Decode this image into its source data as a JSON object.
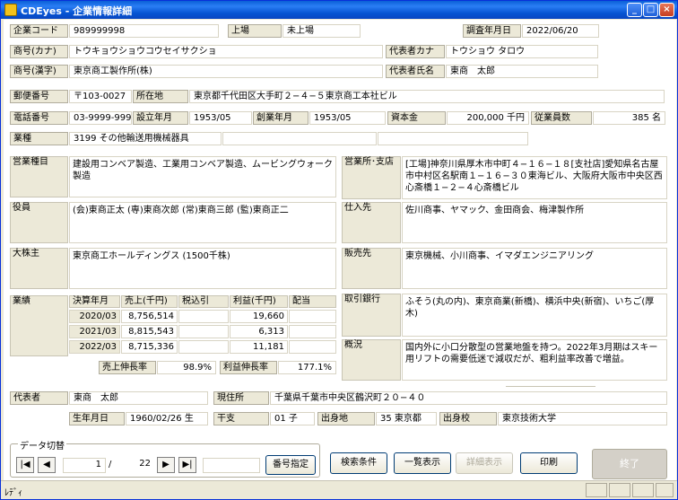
{
  "window": {
    "title": "CDEyes - 企業情報詳細",
    "min": "_",
    "max": "□",
    "close": "×"
  },
  "row1": {
    "company_code_label": "企業コード",
    "company_code": "989999998",
    "listed_label": "上場",
    "listed": "未上場",
    "survey_date_label": "調査年月日",
    "survey_date": "2022/06/20"
  },
  "row2": {
    "name_kana_label": "商号(カナ)",
    "name_kana": "トウキョウショウコウセイサクショ",
    "rep_kana_label": "代表者カナ",
    "rep_kana": "トウショウ タロウ"
  },
  "row3": {
    "name_kanji_label": "商号(漢字)",
    "name_kanji": "東京商工製作所(株)",
    "rep_name_label": "代表者氏名",
    "rep_name": "東商　太郎"
  },
  "row4": {
    "postal_label": "郵便番号",
    "postal": "〒103-0027",
    "address_label": "所在地",
    "address": "東京都千代田区大手町２−４−５東京商工本社ビル"
  },
  "row5": {
    "phone_label": "電話番号",
    "phone": "03-9999-9999",
    "est_label": "設立年月",
    "est": "1953/05",
    "found_label": "創業年月",
    "found": "1953/05",
    "capital_label": "資本金",
    "capital": "200,000 千円",
    "employees_label": "従業員数",
    "employees": "385 名"
  },
  "row6": {
    "industry_label": "業種",
    "industry": "3199 その他輸送用機械器具"
  },
  "business": {
    "label": "営業種目",
    "text": "建設用コンベア製造、工業用コンベア製造、ムービングウォーク製造"
  },
  "offices": {
    "label": "営業所･支店",
    "text": "[工場]神奈川県厚木市中町４−１６−１８[支社店]愛知県名古屋市中村区名駅南１−１６−３０東海ビル、大阪府大阪市中央区西心斎橋１−２−４心斎橋ビル"
  },
  "officers": {
    "label": "役員",
    "text": "(会)東商正太 (専)東商次郎 (常)東商三郎 (監)東商正二"
  },
  "suppliers": {
    "label": "仕入先",
    "text": "佐川商事、ヤマック、金田商会、梅津製作所"
  },
  "shareholders": {
    "label": "大株主",
    "text": "東京商工ホールディングス (1500千株)"
  },
  "customers": {
    "label": "販売先",
    "text": "東京機械、小川商事、イマダエンジニアリング"
  },
  "performance": {
    "label": "業績",
    "headers": [
      "決算年月",
      "売上(千円)",
      "税込引",
      "利益(千円)",
      "配当"
    ],
    "rows": [
      {
        "period": "2020/03",
        "sales": "8,756,514",
        "tax": "",
        "profit": "19,660",
        "dividend": ""
      },
      {
        "period": "2021/03",
        "sales": "8,815,543",
        "tax": "",
        "profit": "6,313",
        "dividend": ""
      },
      {
        "period": "2022/03",
        "sales": "8,715,336",
        "tax": "",
        "profit": "11,181",
        "dividend": ""
      }
    ],
    "sales_growth_label": "売上伸長率",
    "sales_growth": "98.9%",
    "profit_growth_label": "利益伸長率",
    "profit_growth": "177.1%"
  },
  "banks": {
    "label": "取引銀行",
    "text": "ふそう(丸の内)、東京商業(新橋)、横浜中央(新宿)、いちご(厚木)"
  },
  "overview": {
    "label": "概況",
    "text": "国内外に小口分散型の営業地盤を持つ。2022年3月期はスキー用リフトの需要低迷で減収だが、粗利益率改善で増益。"
  },
  "representative": {
    "label": "代表者",
    "name": "東商　太郎",
    "address_label": "現住所",
    "address": "千葉県千葉市中央区鶴沢町２０−４０",
    "birth_label": "生年月日",
    "birth": "1960/02/26 生",
    "zodiac_label": "干支",
    "zodiac": "01 子",
    "birthplace_label": "出身地",
    "birthplace": "35 東京都",
    "school_label": "出身校",
    "school": "東京技術大学"
  },
  "nav": {
    "caption": "データ切替",
    "first": "|◀",
    "prev": "◀",
    "current": "1",
    "slash": "/",
    "total": "22",
    "next": "▶",
    "last": "▶|",
    "jump_value": "",
    "jump_button": "番号指定"
  },
  "buttons": {
    "search": "検索条件",
    "list": "一覧表示",
    "detail": "詳細表示",
    "print": "印刷",
    "exit": "終了"
  },
  "status": {
    "text": "ﾚﾃﾞｨ"
  },
  "colors": {
    "titlebar": "#0a5fd6",
    "label_bg": "#ece9d8",
    "window_bg": "#ffffff"
  }
}
